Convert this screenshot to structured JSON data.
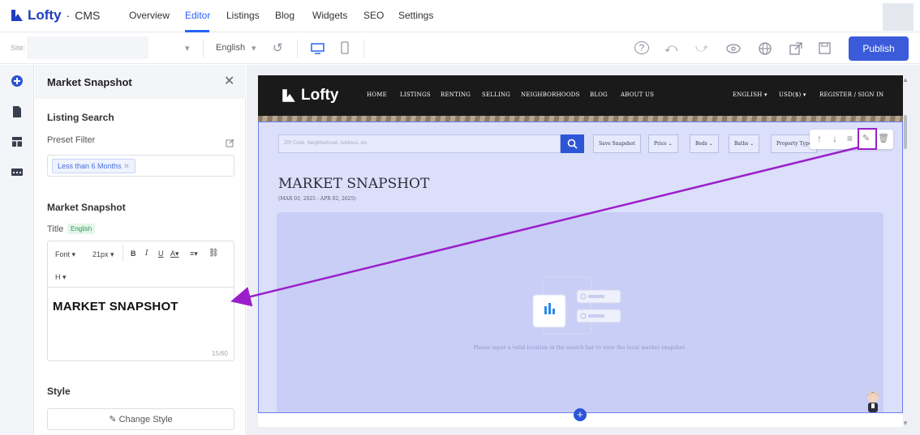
{
  "app": {
    "brand": "Lofty",
    "separator": "·",
    "product": "CMS"
  },
  "nav": {
    "tabs": [
      "Overview",
      "Editor",
      "Listings",
      "Blog",
      "Widgets",
      "SEO",
      "Settings"
    ],
    "active": "Editor"
  },
  "toolbar": {
    "site_label": "Site:",
    "language": "English",
    "publish_label": "Publish",
    "icons": [
      "help-icon",
      "undo-icon",
      "redo-icon",
      "preview-eye-icon",
      "globe-icon",
      "external-link-icon",
      "save-icon"
    ]
  },
  "rail": {
    "icons": [
      "add-circle-icon",
      "page-icon",
      "layout-icon",
      "components-icon"
    ]
  },
  "panel": {
    "title": "Market Snapshot",
    "listing_search_heading": "Listing Search",
    "preset_filter_label": "Preset Filter",
    "filter_tag": "Less than 6 Months",
    "market_snapshot_heading": "Market Snapshot",
    "title_label": "Title",
    "title_lang_badge": "English",
    "editor": {
      "font": "Font",
      "size": "21px",
      "heading": "H",
      "content": "MARKET SNAPSHOT",
      "char_count": "15/60"
    },
    "style_heading": "Style",
    "change_style_label": "Change Style"
  },
  "site": {
    "logo": "Lofty",
    "nav": [
      "HOME",
      "LISTINGS",
      "RENTING",
      "SELLING",
      "NEIGHBORHOODS",
      "BLOG",
      "ABOUT US"
    ],
    "right_nav": [
      "ENGLISH",
      "USD($)",
      "REGISTER / SIGN IN"
    ],
    "search_placeholder": "ZIP Code, Neighborhood, Address, etc.",
    "filters": [
      "Save Snapshot",
      "Price",
      "Beds",
      "Baths",
      "Property Type"
    ],
    "snapshot_title": "MARKET SNAPSHOT",
    "snapshot_dates": "(MAR 03, 2025 - APR 02, 2025)",
    "empty_message": "Please input a valid location in the search bar to view the local market snapshot."
  },
  "colors": {
    "accent": "#2962ff",
    "publish": "#3b5bdb",
    "annotation": "#9b1fc9",
    "selection": "#6d7ff0"
  }
}
